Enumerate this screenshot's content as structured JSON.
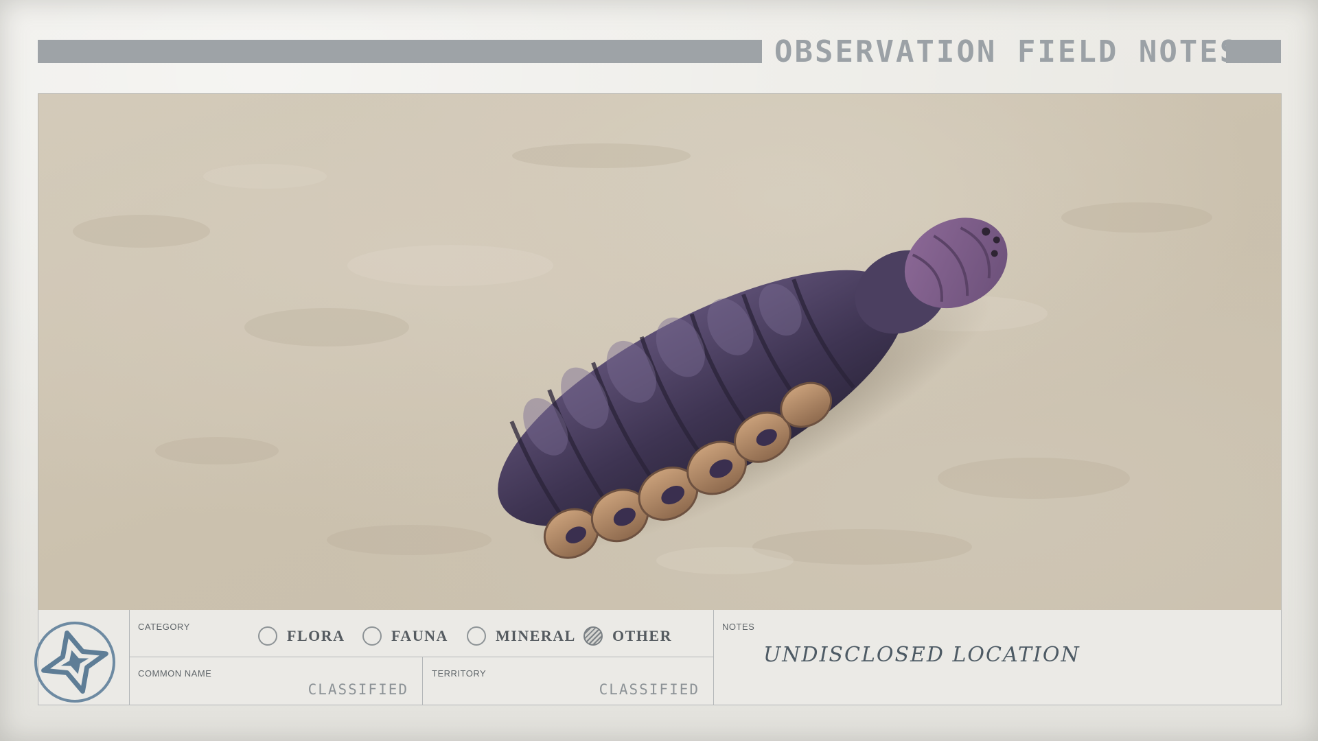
{
  "header": {
    "title": "OBSERVATION FIELD NOTES"
  },
  "photo": {
    "subject_icon": "creature-specimen"
  },
  "info": {
    "logo_icon": "constellation-star-logo",
    "category": {
      "label": "CATEGORY",
      "options": [
        {
          "label": "FLORA",
          "selected": false
        },
        {
          "label": "FAUNA",
          "selected": false
        },
        {
          "label": "MINERAL",
          "selected": false
        },
        {
          "label": "OTHER",
          "selected": true
        }
      ]
    },
    "common_name": {
      "label": "COMMON NAME",
      "value": "CLASSIFIED"
    },
    "territory": {
      "label": "TERRITORY",
      "value": "CLASSIFIED"
    },
    "notes": {
      "label": "NOTES",
      "value": "UNDISCLOSED LOCATION"
    }
  },
  "colors": {
    "header_bar": "#9ea3a7",
    "paper": "#e7e6e1",
    "sand": "#cfc6b4",
    "creature_purple": "#4a3f5e",
    "creature_tan": "#b58e6a",
    "ink": "#4d5a64"
  }
}
